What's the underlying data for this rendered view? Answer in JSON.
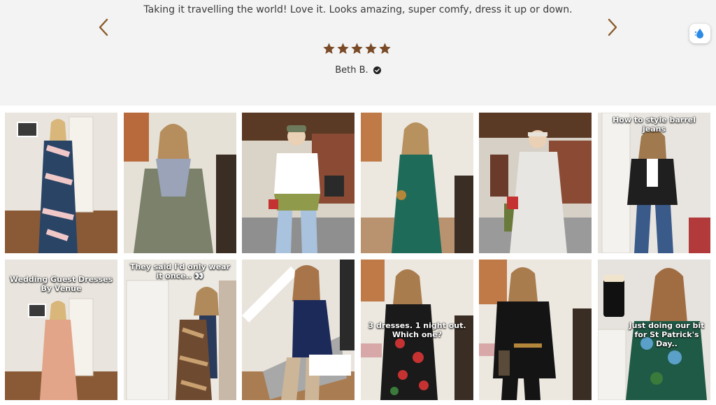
{
  "review": {
    "text": "Taking it travelling the world! Love it. Looks amazing, super comfy, dress it up or down.",
    "rating": 5,
    "max_rating": 5,
    "reviewer": "Beth B.",
    "verified_icon": "check-circle-icon",
    "star_color": "#7a4a26"
  },
  "navigation": {
    "prev_icon": "chevron-left-icon",
    "next_icon": "chevron-right-icon",
    "arrow_color": "#8b5a2b"
  },
  "accessibility_widget": {
    "icon": "water-drop-icon"
  },
  "gallery": {
    "items": [
      {
        "caption": ""
      },
      {
        "caption": ""
      },
      {
        "caption": ""
      },
      {
        "caption": ""
      },
      {
        "caption": ""
      },
      {
        "caption": "How to style barrel jeans"
      },
      {
        "caption": "Wedding Guest Dresses By Venue"
      },
      {
        "caption": "They said I'd only wear it once.. 👀"
      },
      {
        "caption": ""
      },
      {
        "caption": "3 dresses. 1 night out. Which one?"
      },
      {
        "caption": ""
      },
      {
        "caption": "Just doing our bit for St Patrick's Day.."
      }
    ]
  }
}
